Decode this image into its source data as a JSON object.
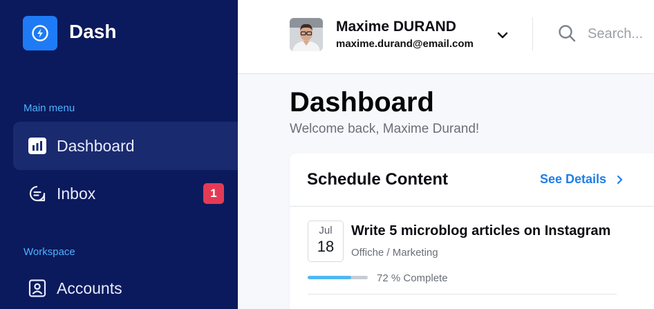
{
  "app": {
    "name": "Dash",
    "brand_color": "#1e7bf5",
    "sidebar_color": "#0b1a5c",
    "logo_icon": "lightning-bolt-icon"
  },
  "sidebar": {
    "main_menu_label": "Main menu",
    "workspace_label": "Workspace",
    "items": [
      {
        "label": "Dashboard",
        "icon": "bar-chart-icon",
        "active": true
      },
      {
        "label": "Inbox",
        "icon": "inbox-icon",
        "badge": "1"
      },
      {
        "label": "Accounts",
        "icon": "user-card-icon"
      }
    ]
  },
  "header": {
    "user_name": "Maxime DURAND",
    "user_email": "maxime.durand@email.com",
    "search_placeholder": "Search..."
  },
  "page": {
    "title": "Dashboard",
    "subtitle": "Welcome back, Maxime Durand!"
  },
  "schedule": {
    "title": "Schedule Content",
    "see_details": "See Details",
    "items": [
      {
        "month": "Jul",
        "day": "18",
        "title": "Write 5 microblog articles on Instagram",
        "tag": "Offiche / Marketing",
        "progress": 0.72,
        "progress_text": "72 % Complete"
      }
    ]
  },
  "colors": {
    "accent_link": "#1f7ee8",
    "badge": "#e33b55",
    "progress": "#4fb8f0",
    "section_label": "#4fb2ff"
  }
}
